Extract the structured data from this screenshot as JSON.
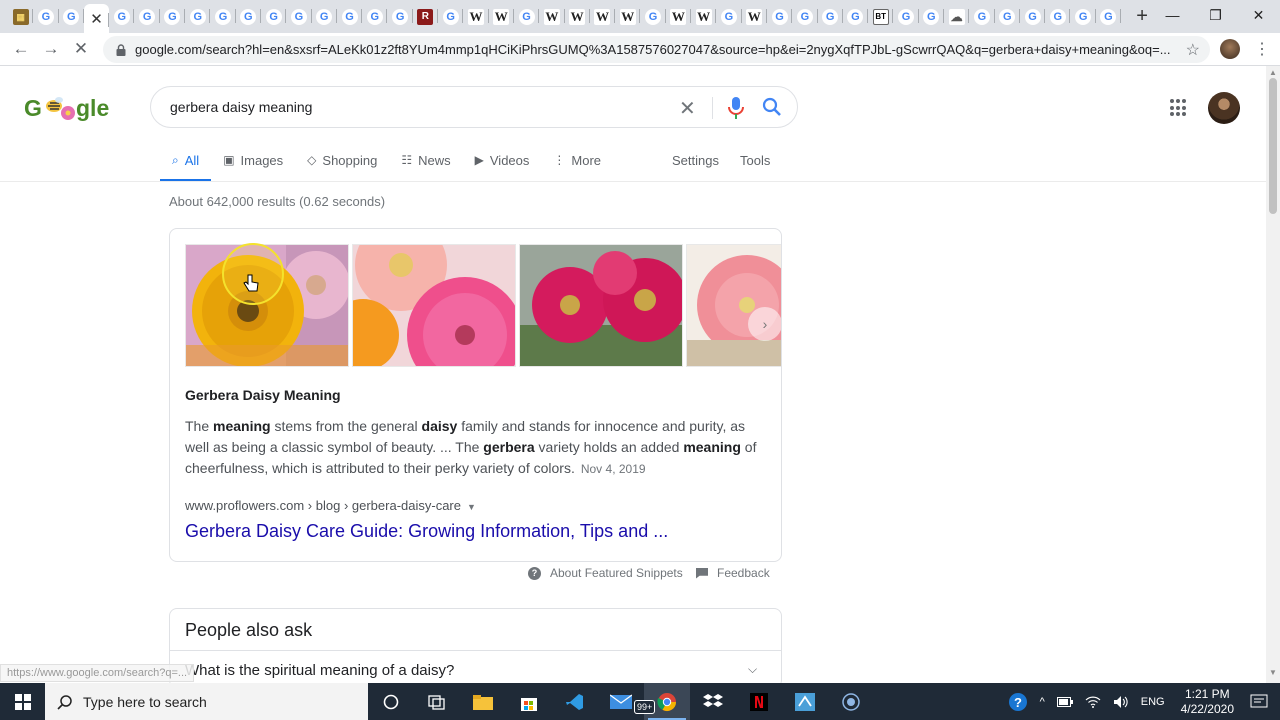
{
  "browser": {
    "tab_favicons": [
      "site",
      "google",
      "google",
      "google",
      "google",
      "google",
      "google",
      "google",
      "google",
      "google",
      "google",
      "google",
      "google",
      "google",
      "google",
      "site-r",
      "google",
      "wiki",
      "wiki",
      "google",
      "wiki",
      "wiki",
      "wiki",
      "wiki",
      "google",
      "wiki",
      "wiki",
      "google",
      "wiki",
      "google",
      "google",
      "google",
      "google",
      "site-bt",
      "google",
      "google",
      "site-c",
      "google",
      "google",
      "google",
      "google",
      "google",
      "google"
    ],
    "favicon_letters": {
      "google": "G",
      "wiki": "W",
      "site": "▦",
      "site-r": "R",
      "site-bt": "BT",
      "site-c": "☁"
    },
    "new_tab_label": "+",
    "url": "google.com/search?hl=en&sxsrf=ALeKk01z2ft8YUm4mmp1qHCiKiPhrsGUMQ%3A1587576027047&source=hp&ei=2nygXqfTPJbL-gScwrrQAQ&q=gerbera+daisy+meaning&oq=..."
  },
  "google": {
    "logo_text": "Ggle",
    "query": "gerbera daisy meaning",
    "tabs": [
      {
        "label": "All",
        "icon": "search-icon",
        "active": true
      },
      {
        "label": "Images",
        "icon": "image-icon"
      },
      {
        "label": "Shopping",
        "icon": "tag-icon"
      },
      {
        "label": "News",
        "icon": "news-icon"
      },
      {
        "label": "Videos",
        "icon": "play-icon"
      },
      {
        "label": "More",
        "icon": "dots-vertical-icon"
      }
    ],
    "settings_label": "Settings",
    "tools_label": "Tools",
    "result_stats": "About 642,000 results (0.62 seconds)"
  },
  "snippet": {
    "images": [
      "yellow-gerbera-daisy",
      "pink-and-orange-gerbera",
      "magenta-gerbera-daisies",
      "pink-gerbera-in-burlap"
    ],
    "title": "Gerbera Daisy Meaning",
    "body": [
      {
        "t": "The ",
        "b": false
      },
      {
        "t": "meaning",
        "b": true
      },
      {
        "t": " stems from the general ",
        "b": false
      },
      {
        "t": "daisy",
        "b": true
      },
      {
        "t": " family and stands for innocence and purity, as well as being a classic symbol of beauty. ... The ",
        "b": false
      },
      {
        "t": "gerbera",
        "b": true
      },
      {
        "t": " variety holds an added ",
        "b": false
      },
      {
        "t": "meaning",
        "b": true
      },
      {
        "t": " of cheerfulness, which is attributed to their perky variety of colors.",
        "b": false
      }
    ],
    "date": "Nov 4, 2019",
    "cite": "www.proflowers.com › blog › gerbera-daisy-care",
    "link_text": "Gerbera Daisy Care Guide: Growing Information, Tips and ...",
    "about_label": "About Featured Snippets",
    "feedback_label": "Feedback"
  },
  "paa": {
    "title": "People also ask",
    "questions": [
      "What is the spiritual meaning of a daisy?"
    ]
  },
  "status_bar_url": "https://www.google.com/search?q=...",
  "taskbar": {
    "search_placeholder": "Type here to search",
    "apps": [
      "cortana-icon",
      "task-view-icon",
      "file-explorer-icon",
      "store-icon",
      "vscode-icon",
      "mail-icon",
      "chrome-icon",
      "dropbox-icon",
      "netflix-icon",
      "teams-icon",
      "obs-icon"
    ],
    "mail_badge": "99+",
    "language": "ENG",
    "time": "1:21 PM",
    "date": "4/22/2020"
  },
  "colors": {
    "link": "#1a0dab",
    "accent": "#1a73e8",
    "taskbar": "#1f2a37"
  }
}
